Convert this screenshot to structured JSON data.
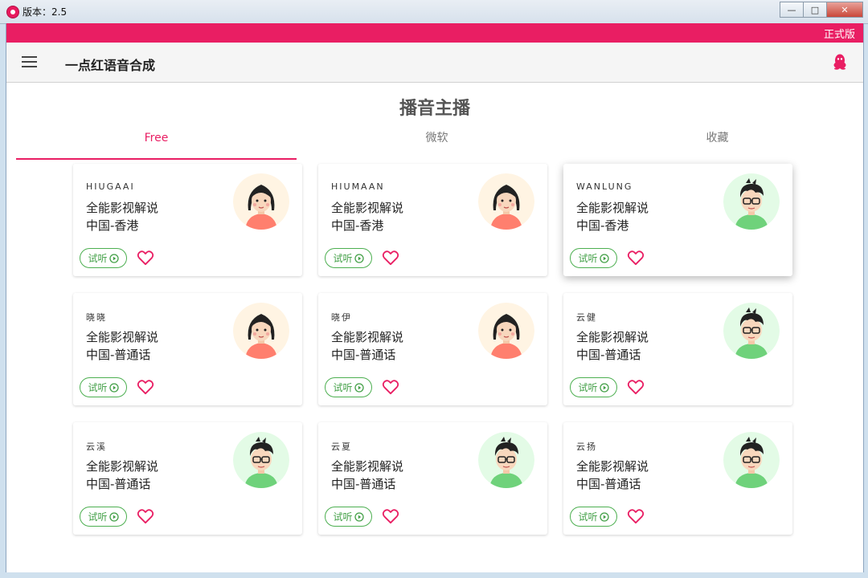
{
  "window": {
    "title": "版本：2.5",
    "controls": {
      "minimize": "—",
      "maximize": "□",
      "close": "✕"
    }
  },
  "edition": "正式版",
  "appbar": {
    "title": "一点红语音合成",
    "menu_icon": "hamburger-icon",
    "right_icon": "qq-penguin-icon"
  },
  "page": {
    "heading": "播音主播"
  },
  "tabs": [
    {
      "label": "Free",
      "active": true
    },
    {
      "label": "微软",
      "active": false
    },
    {
      "label": "收藏",
      "active": false
    }
  ],
  "listen_label": "试听",
  "colors": {
    "accent": "#e91e63",
    "listen": "#4caf50",
    "female_bg": "#fff4e3",
    "male_bg": "#e3fbe6"
  },
  "voices": [
    {
      "name": "HIUGAAI",
      "desc": "全能影视解说",
      "lang": "中国-香港",
      "gender": "female"
    },
    {
      "name": "HIUMAAN",
      "desc": "全能影视解说",
      "lang": "中国-香港",
      "gender": "female"
    },
    {
      "name": "WANLUNG",
      "desc": "全能影视解说",
      "lang": "中国-香港",
      "gender": "male"
    },
    {
      "name": "晓晓",
      "desc": "全能影视解说",
      "lang": "中国-普通话",
      "gender": "female"
    },
    {
      "name": "晓伊",
      "desc": "全能影视解说",
      "lang": "中国-普通话",
      "gender": "female"
    },
    {
      "name": "云健",
      "desc": "全能影视解说",
      "lang": "中国-普通话",
      "gender": "male"
    },
    {
      "name": "云溪",
      "desc": "全能影视解说",
      "lang": "中国-普通话",
      "gender": "male"
    },
    {
      "name": "云夏",
      "desc": "全能影视解说",
      "lang": "中国-普通话",
      "gender": "male"
    },
    {
      "name": "云扬",
      "desc": "全能影视解说",
      "lang": "中国-普通话",
      "gender": "male"
    }
  ]
}
